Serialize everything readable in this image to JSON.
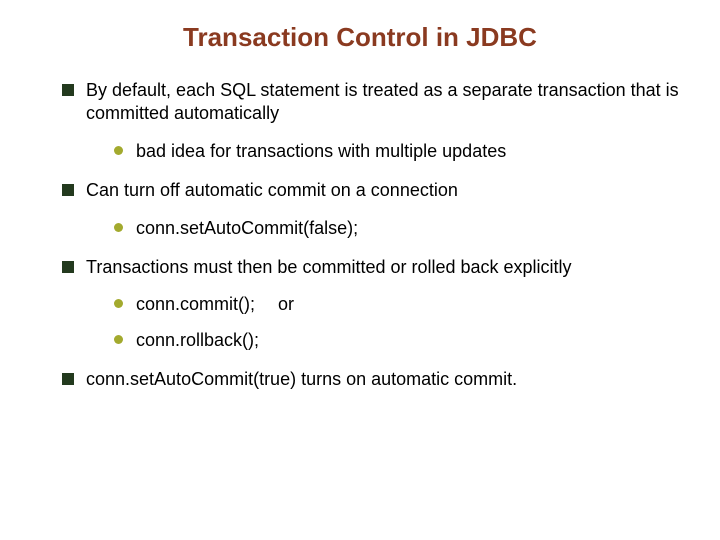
{
  "title": "Transaction Control in JDBC",
  "bullets": [
    {
      "text": "By default, each SQL statement is treated as a separate transaction that is committed automatically",
      "sub": [
        {
          "text": "bad idea for transactions with multiple updates"
        }
      ]
    },
    {
      "text": "Can turn off automatic commit on a connection",
      "sub": [
        {
          "text": "conn.setAutoCommit(false);"
        }
      ]
    },
    {
      "text": "Transactions must then be committed or rolled back explicitly",
      "sub": [
        {
          "text": "conn.commit();",
          "suffix": "or"
        },
        {
          "text": "conn.rollback();"
        }
      ]
    },
    {
      "text": "conn.setAutoCommit(true) turns on automatic commit.",
      "sub": []
    }
  ]
}
